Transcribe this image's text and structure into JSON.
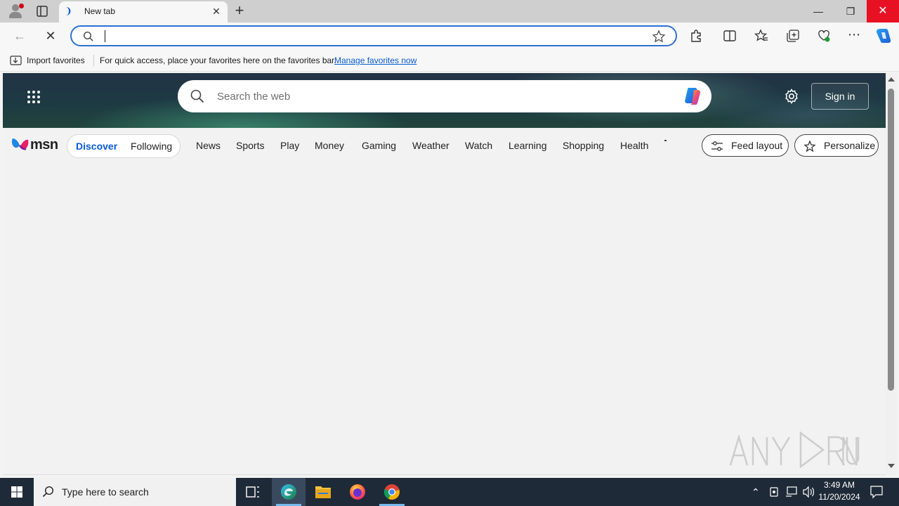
{
  "browser": {
    "tab": {
      "title": "New tab"
    },
    "address_bar": {
      "value": "",
      "placeholder": ""
    },
    "favorites_bar": {
      "import_label": "Import favorites",
      "message": "For quick access, place your favorites here on the favorites bar.",
      "link": "Manage favorites now"
    }
  },
  "msn": {
    "search_placeholder": "Search the web",
    "sign_in": "Sign in",
    "logo_text": "msn",
    "feed_tabs": {
      "discover": "Discover",
      "following": "Following"
    },
    "nav": [
      "News",
      "Sports",
      "Play",
      "Money",
      "Gaming",
      "Weather",
      "Watch",
      "Learning",
      "Shopping",
      "Health"
    ],
    "feed_layout": "Feed layout",
    "personalize": "Personalize"
  },
  "taskbar": {
    "search_placeholder": "Type here to search",
    "time": "3:49 AM",
    "date": "11/20/2024"
  },
  "colors": {
    "accent": "#0a5bd3",
    "close_red": "#e81123",
    "taskbar": "#1f2a38"
  }
}
